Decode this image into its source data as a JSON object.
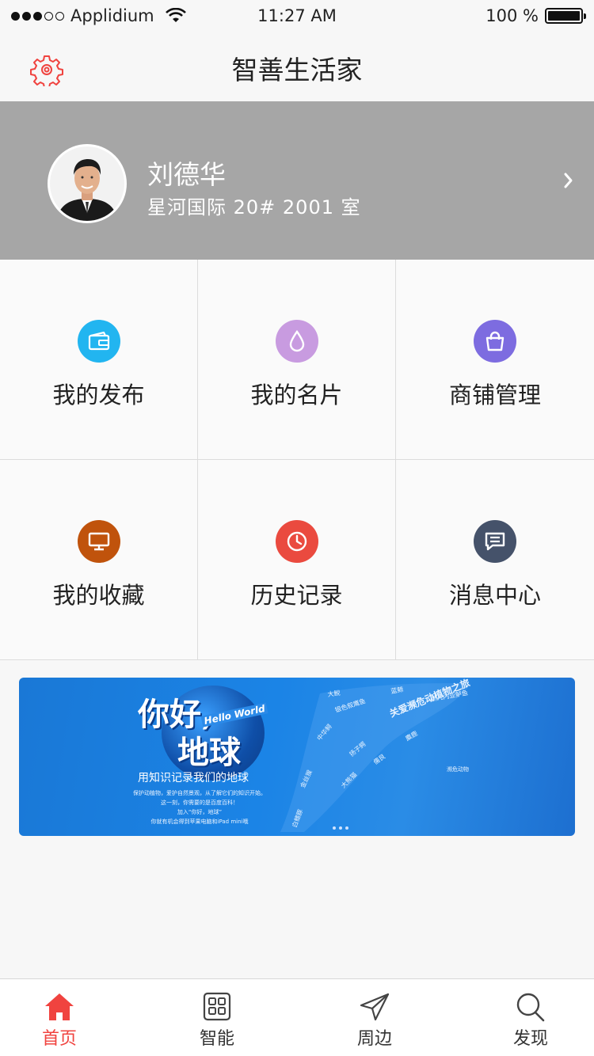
{
  "status_bar": {
    "carrier": "Applidium",
    "time": "11:27 AM",
    "battery": "100 %"
  },
  "header": {
    "title": "智善生活家"
  },
  "profile": {
    "name": "刘德华",
    "address": "星河国际 20# 2001 室"
  },
  "menu": [
    {
      "label": "我的发布",
      "icon": "wallet-icon",
      "color": "#22b5f0"
    },
    {
      "label": "我的名片",
      "icon": "droplet-icon",
      "color": "#c89be0"
    },
    {
      "label": "商铺管理",
      "icon": "shopping-bag-icon",
      "color": "#7d6ce0"
    },
    {
      "label": "我的收藏",
      "icon": "monitor-icon",
      "color": "#c0530c"
    },
    {
      "label": "历史记录",
      "icon": "clock-icon",
      "color": "#ea4a3f"
    },
    {
      "label": "消息中心",
      "icon": "chat-icon",
      "color": "#45526a"
    }
  ],
  "banner": {
    "big_line1": "你好,",
    "big_line2": "地球",
    "hello": "Hello World",
    "subtitle": "用知识记录我们的地球",
    "small1": "保护动植物，爱护自然景观，从了解它们的知识开始。",
    "small2": "这一刻，你需要的是百度百科！",
    "small3": "加入“你好，地球”",
    "small4": "你就有机会得到苹果电脑和iPad mini哦",
    "cloud_words": [
      "关爱濒危动植物之旅",
      "濒危动物",
      "大鲵",
      "蓝鲸",
      "新几内亚鲈鱼",
      "银色叙鹰鱼",
      "中华鲟",
      "扬子鳄",
      "金丝猴",
      "大熊猫",
      "白鳍豚",
      "儒艮",
      "麋鹿"
    ]
  },
  "tabbar": [
    {
      "label": "首页",
      "icon": "home-icon",
      "active": true
    },
    {
      "label": "智能",
      "icon": "grid-icon",
      "active": false
    },
    {
      "label": "周边",
      "icon": "send-icon",
      "active": false
    },
    {
      "label": "发现",
      "icon": "search-icon",
      "active": false
    }
  ]
}
